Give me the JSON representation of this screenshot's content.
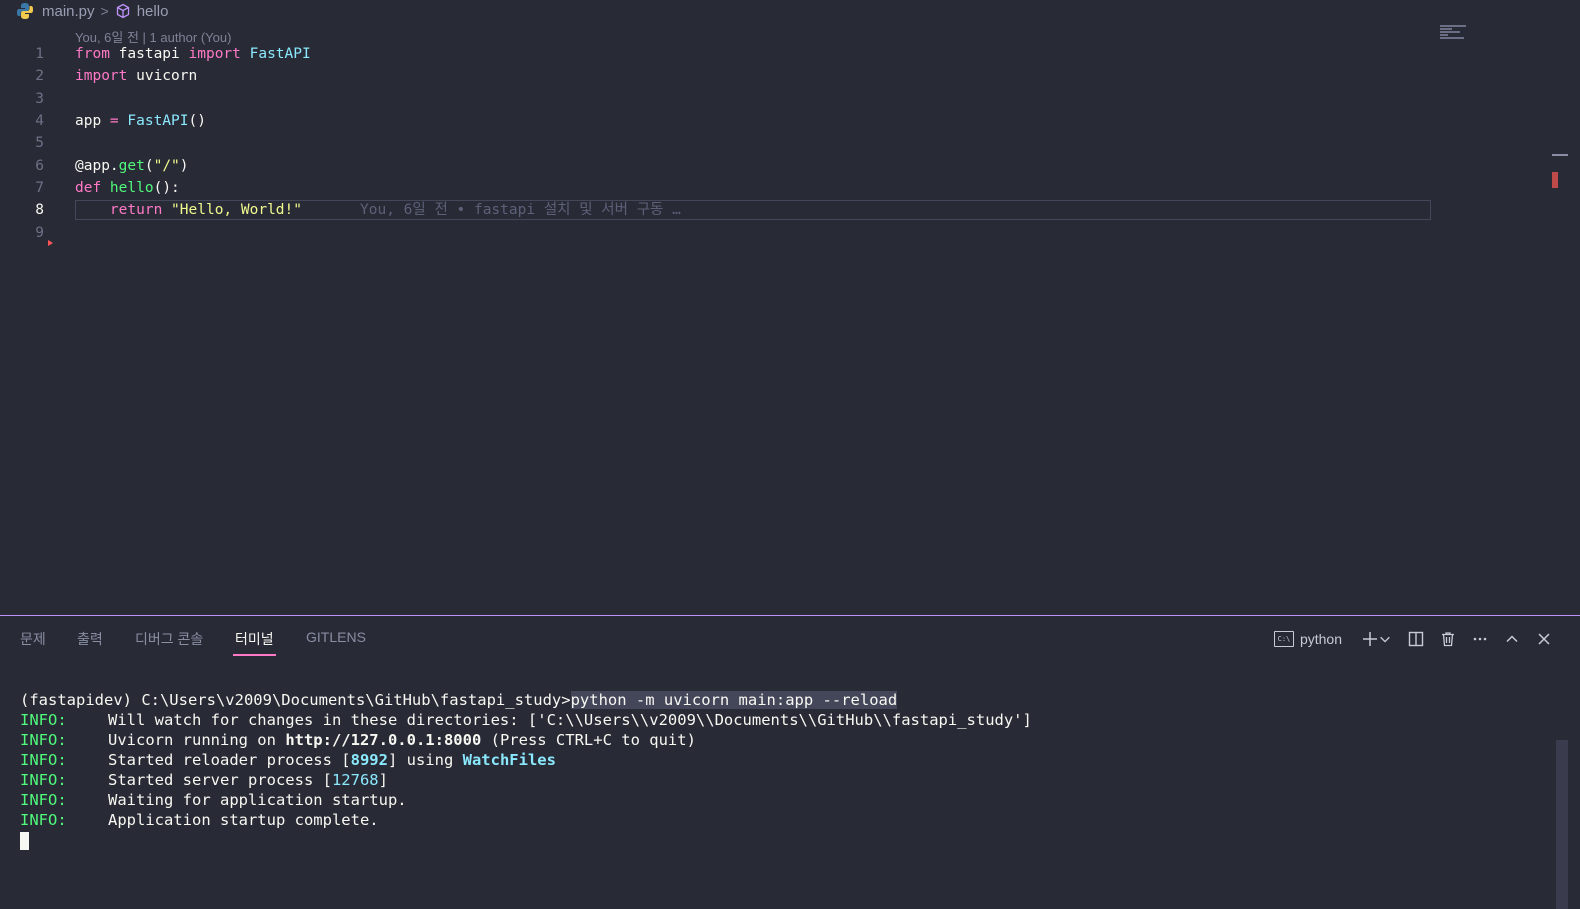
{
  "breadcrumb": {
    "file": "main.py",
    "separator": ">",
    "symbol": "hello"
  },
  "editor": {
    "codelens": "You, 6일 전 | 1 author (You)",
    "active_line": 8,
    "line_numbers": [
      "1",
      "2",
      "3",
      "4",
      "5",
      "6",
      "7",
      "8",
      "9"
    ],
    "code": {
      "l1": {
        "kw1": "from",
        "mod": " fastapi ",
        "kw2": "import",
        "cls": " FastAPI"
      },
      "l2": {
        "kw": "import",
        "mod": " uvicorn"
      },
      "l4": {
        "var": "app ",
        "op": "=",
        "cls": " FastAPI",
        "paren": "()"
      },
      "l6": {
        "dec": "@app.",
        "fn": "get",
        "p1": "(",
        "str": "\"/\"",
        "p2": ")"
      },
      "l7": {
        "kw": "def",
        "fn": " hello",
        "rest": "():"
      },
      "l8": {
        "indent": "    ",
        "kw": "return",
        "str": " \"Hello, World!\""
      }
    },
    "blame": "You, 6일 전 • fastapi 설치 및 서버 구동 …"
  },
  "panel": {
    "tabs": [
      "문제",
      "출력",
      "디버그 콘솔",
      "터미널",
      "GITLENS"
    ],
    "active_tab": "터미널",
    "terminal_name": "python",
    "cmd_icon_text": "C:\\"
  },
  "terminal": {
    "prompt": "(fastapidev) C:\\Users\\v2009\\Documents\\GitHub\\fastapi_study>",
    "command": "python -m uvicorn main:app --reload",
    "info_label": "INFO:",
    "lines": {
      "watch": "Will watch for changes in these directories: ['C:\\\\Users\\\\v2009\\\\Documents\\\\GitHub\\\\fastapi_study']",
      "running_pre": "Uvicorn running on ",
      "running_url": "http://127.0.0.1:8000",
      "running_post": " (Press CTRL+C to quit)",
      "reloader_pre": "Started reloader process [",
      "reloader_pid": "8992",
      "reloader_mid": "] using ",
      "reloader_tool": "WatchFiles",
      "server_pre": "Started server process [",
      "server_pid": "12768",
      "server_post": "]",
      "waiting": "Waiting for application startup.",
      "complete": "Application startup complete."
    }
  },
  "colors": {
    "background": "#282a36",
    "accent": "#bd93f9",
    "active_tab_underline": "#ff79c6",
    "info_green": "#50fa7b"
  }
}
